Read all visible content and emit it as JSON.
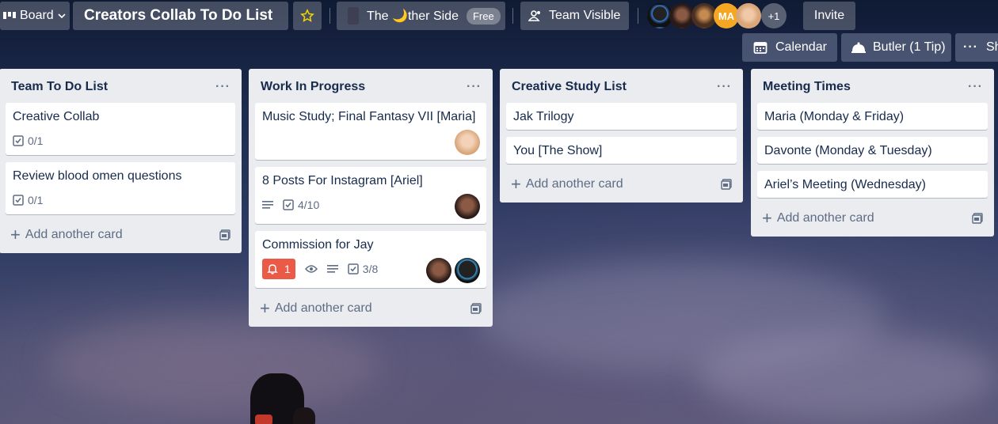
{
  "header": {
    "board_label": "Board",
    "board_title": "Creators Collab To Do List",
    "team_name": "The 🌙ther Side",
    "team_plan": "Free",
    "visibility": "Team Visible",
    "member_initials": "MA",
    "extra_members": "+1",
    "invite_label": "Invite",
    "calendar_label": "Calendar",
    "butler_label": "Butler (1 Tip)",
    "show_menu_label": "Sh"
  },
  "lists": [
    {
      "title": "Team To Do List",
      "cards": [
        {
          "title": "Creative Collab",
          "checklist": "0/1"
        },
        {
          "title": "Review blood omen questions",
          "checklist": "0/1"
        }
      ],
      "add_card_label": "Add another card"
    },
    {
      "title": "Work In Progress",
      "cards": [
        {
          "title": "Music Study; Final Fantasy VII [Maria]"
        },
        {
          "title": "8 Posts For Instagram [Ariel]",
          "checklist": "4/10"
        },
        {
          "title": "Commission for Jay",
          "notifications": "1",
          "checklist": "3/8"
        }
      ],
      "add_card_label": "Add another card"
    },
    {
      "title": "Creative Study List",
      "cards": [
        {
          "title": "Jak Trilogy"
        },
        {
          "title": "You [The Show]"
        }
      ],
      "add_card_label": "Add another card"
    },
    {
      "title": "Meeting Times",
      "cards": [
        {
          "title": "Maria (Monday & Friday)"
        },
        {
          "title": "Davonte (Monday & Tuesday)"
        },
        {
          "title": "Ariel’s Meeting (Wednesday)"
        }
      ],
      "add_card_label": "Add another card"
    }
  ],
  "colors": {
    "list_bg": "#ebecf0",
    "alert_badge": "#eb5a46",
    "member_ma": "#f5a623"
  }
}
